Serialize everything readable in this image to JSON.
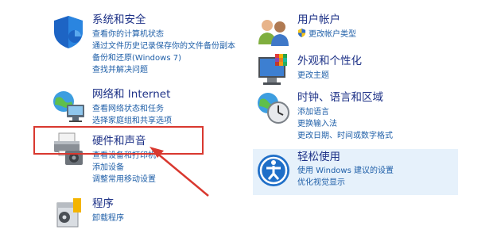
{
  "categories": {
    "system_security": {
      "title": "系统和安全",
      "icon": "shield-icon",
      "links": [
        "查看你的计算机状态",
        "通过文件历史记录保存你的文件备份副本",
        "备份和还原(Windows 7)",
        "查找并解决问题"
      ]
    },
    "network": {
      "title": "网络和 Internet",
      "icon": "network-globe-icon",
      "links": [
        "查看网络状态和任务",
        "选择家庭组和共享选项"
      ]
    },
    "hardware_sound": {
      "title": "硬件和声音",
      "icon": "printer-speaker-icon",
      "links": [
        "查看设备和打印机",
        "添加设备",
        "调整常用移动设置"
      ]
    },
    "programs": {
      "title": "程序",
      "icon": "programs-box-icon",
      "links": [
        "卸载程序"
      ]
    },
    "user_accounts": {
      "title": "用户帐户",
      "icon": "users-icon",
      "links": [
        "更改帐户类型"
      ],
      "link_icon": "uac-shield-icon"
    },
    "appearance": {
      "title": "外观和个性化",
      "icon": "monitor-palette-icon",
      "links": [
        "更改主题"
      ]
    },
    "clock_region": {
      "title": "时钟、语言和区域",
      "icon": "clock-globe-icon",
      "links": [
        "添加语言",
        "更换输入法",
        "更改日期、时间或数字格式"
      ]
    },
    "ease_of_access": {
      "title": "轻松使用",
      "icon": "ease-of-access-icon",
      "links": [
        "使用 Windows 建议的设置",
        "优化视觉显示"
      ]
    }
  },
  "annotation": {
    "highlight_color": "#d9382f",
    "target": "硬件和声音"
  },
  "colors": {
    "title": "#1e3287",
    "link": "#1f5fa8",
    "selected_bg": "#e6f1fb"
  }
}
